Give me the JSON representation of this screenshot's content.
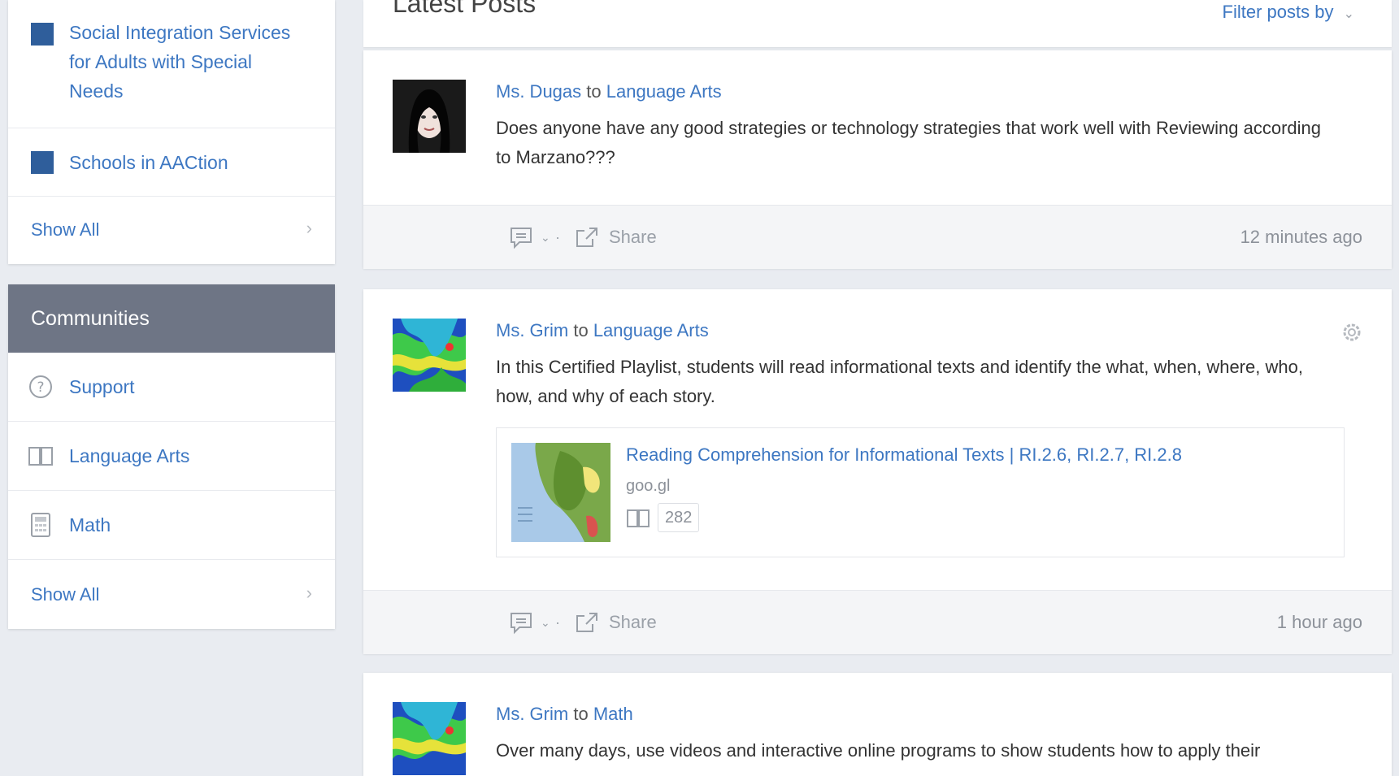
{
  "sidebar": {
    "groups": {
      "items": [
        {
          "label_lines": [
            "Social Integration Services",
            "for Adults with Special",
            "Needs"
          ]
        },
        {
          "label": "Schools in AACtion"
        }
      ],
      "show_all": "Show All"
    },
    "communities": {
      "title": "Communities",
      "items": [
        {
          "label": "Support",
          "icon": "question-circle-icon"
        },
        {
          "label": "Language Arts",
          "icon": "open-book-icon"
        },
        {
          "label": "Math",
          "icon": "calculator-icon"
        }
      ],
      "show_all": "Show All"
    }
  },
  "main": {
    "title": "Latest Posts",
    "filter_label": "Filter posts by",
    "posts": [
      {
        "author": "Ms. Dugas",
        "to": "to",
        "community": "Language Arts",
        "body": "Does anyone have any good strategies or technology strategies that work well with Reviewing according to Marzano???",
        "share": "Share",
        "time": "12 minutes ago"
      },
      {
        "author": "Ms. Grim",
        "to": "to",
        "community": "Language Arts",
        "body": "In this Certified Playlist, students will read informational texts and identify the what, when, where, who, how, and why of each story.",
        "attachment": {
          "title": "Reading Comprehension for Informational Texts | RI.2.6, RI.2.7, RI.2.8",
          "domain": "goo.gl",
          "count": "282"
        },
        "share": "Share",
        "time": "1 hour ago"
      },
      {
        "author": "Ms. Grim",
        "to": "to",
        "community": "Math",
        "body": "Over many days, use videos and interactive online programs to show students how to apply their"
      }
    ]
  },
  "colors": {
    "link": "#3d77c2",
    "group_square": "#2f5e9b",
    "communities_header": "#6e7585",
    "page_background": "#e9ecf1"
  }
}
